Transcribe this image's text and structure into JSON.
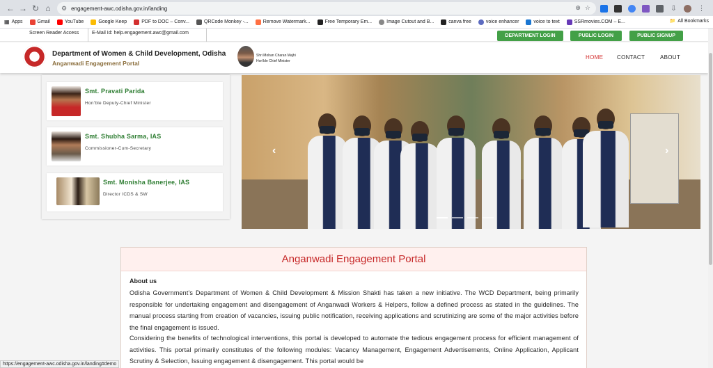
{
  "browser": {
    "url": "engagement-awc.odisha.gov.in/landing",
    "bookmarks": [
      "Apps",
      "Gmail",
      "YouTube",
      "Google Keep",
      "PDF to DOC – Conv...",
      "QRCode Monkey -...",
      "Remove Watermark...",
      "Free Temporary Em...",
      "Image Cutout and B...",
      "canva free",
      "voice enhancer",
      "voice to text",
      "SSRmovies.COM – E..."
    ],
    "all_bookmarks": "All Bookmarks",
    "status_url": "https://engagement-awc.odisha.gov.in/landing#demo"
  },
  "topstrip": {
    "screen_reader": "Screen Reader Access",
    "email": "E-Mail Id: help.engagement.awc@gmail.com",
    "buttons": [
      "DEPARTMENT LOGIN",
      "PUBLIC LOGIN",
      "PUBLIC SIGNUP"
    ]
  },
  "header": {
    "department": "Department of Women & Child Development, Odisha",
    "portal": "Anganwadi Engagement Portal",
    "cm_name": "Shri Mohan Charan Majhi",
    "cm_title": "Hon'ble Chief Minister",
    "nav": [
      "HOME",
      "CONTACT",
      "ABOUT"
    ]
  },
  "officials": [
    {
      "name": "Smt. Pravati Parida",
      "title": "Hon'ble Deputy-Chief Minister"
    },
    {
      "name": "Smt. Shubha Sarma, IAS",
      "title": "Commissioner-Cum-Secretary"
    },
    {
      "name": "Smt. Monisha Banerjee, IAS",
      "title": "Director ICDS & SW"
    }
  ],
  "carousel": {
    "prev": "‹",
    "next": "›"
  },
  "portal_section": {
    "title": "Anganwadi Engagement Portal",
    "about_heading": "About us",
    "p1": "Odisha Government's Department of Women & Child Development & Mission Shakti has taken a new initiative. The WCD Department, being primarily responsible for undertaking engagement and disengagement of Anganwadi Workers & Helpers, follow a defined process as stated in the guidelines. The manual process starting from creation of vacancies, issuing public notification, receiving applications and scrutinizing are some of the major activities before the final engagement is issued.",
    "p2": "Considering the benefits of technological interventions, this portal is developed to automate the tedious engagement process for efficient management of activities. This portal primarily constitutes of the following modules: Vacancy Management, Engagement Advertisements, Online Application, Applicant Scrutiny & Selection, Issuing engagement & disengagement. This portal would be"
  }
}
